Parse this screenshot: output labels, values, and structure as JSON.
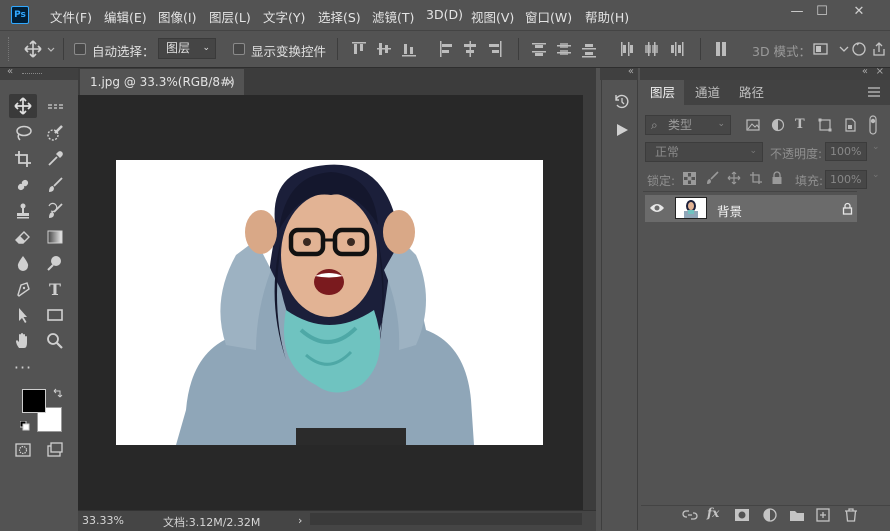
{
  "app": {
    "logo": "Ps",
    "window_controls": [
      "—",
      "☐",
      "✕"
    ]
  },
  "menu": [
    "文件(F)",
    "编辑(E)",
    "图像(I)",
    "图层(L)",
    "文字(Y)",
    "选择(S)",
    "滤镜(T)",
    "3D(D)",
    "视图(V)",
    "窗口(W)",
    "帮助(H)"
  ],
  "options": {
    "auto_select_label": "自动选择：",
    "auto_select_value": "图层",
    "show_transform_label": "显示变换控件",
    "mode_3d_label": "3D 模式："
  },
  "document": {
    "tab_title": "1.jpg @ 33.3%(RGB/8#)",
    "tab_close": "×",
    "zoom": "33.33%",
    "doc_info": "文档:3.12M/2.32M",
    "status_arrow": "›"
  },
  "layers_panel": {
    "tabs": [
      "图层",
      "通道",
      "路径"
    ],
    "active_tab": "图层",
    "filter_kind": "类型",
    "blend_mode": "正常",
    "opacity_label": "不透明度:",
    "opacity_value": "100%",
    "lock_label": "锁定:",
    "fill_label": "填充:",
    "fill_value": "100%",
    "layers": [
      {
        "name": "背景",
        "visible": true,
        "locked": true
      }
    ]
  },
  "colors": {
    "foreground": "#000000",
    "background": "#ffffff",
    "accent": "#31a8ff"
  }
}
